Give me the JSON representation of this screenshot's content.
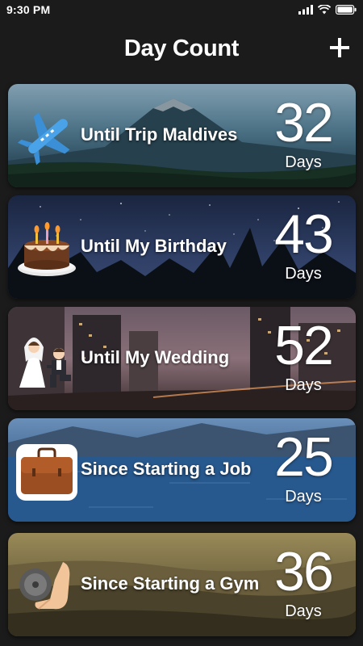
{
  "status_bar": {
    "time": "9:30 PM"
  },
  "header": {
    "title": "Day Count",
    "add_icon": "plus-icon"
  },
  "events": [
    {
      "label": "Until Trip Maldives",
      "count": "32",
      "unit": "Days",
      "icon": "airplane-icon"
    },
    {
      "label": "Until My Birthday",
      "count": "43",
      "unit": "Days",
      "icon": "birthday-cake-icon"
    },
    {
      "label": "Until My Wedding",
      "count": "52",
      "unit": "Days",
      "icon": "wedding-couple-icon"
    },
    {
      "label": "Since Starting a Job",
      "count": "25",
      "unit": "Days",
      "icon": "briefcase-icon"
    },
    {
      "label": "Since Starting a Gym",
      "count": "36",
      "unit": "Days",
      "icon": "dumbbell-icon"
    }
  ],
  "colors": {
    "background": "#1b1b1b",
    "text": "#ffffff"
  }
}
